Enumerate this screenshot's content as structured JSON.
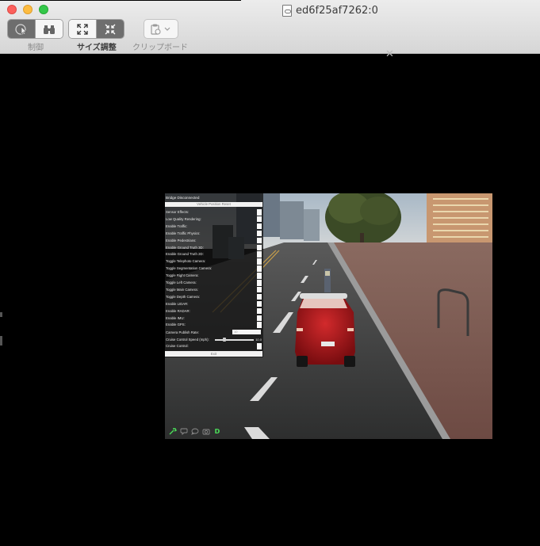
{
  "window": {
    "title": "ed6f25af7262:0"
  },
  "toolbar": {
    "control_label": "制御",
    "resize_label": "サイズ調整",
    "clipboard_label": "クリップボード"
  },
  "icons": {
    "control_pointer": "pointer-icon",
    "control_binoculars": "binoculars-icon",
    "resize_expand": "expand-icon",
    "resize_shrink": "shrink-icon",
    "clipboard": "clipboard-icon",
    "close": "close-icon"
  },
  "sim": {
    "status": "Bridge Disconnected",
    "reset_label": "Vehicle Position Reset",
    "exit_label": "Exit",
    "toggles": [
      "Sensor Effects:",
      "Low Quality Rendering:",
      "Enable Traffic:",
      "Enable Traffic Physics:",
      "Enable Pedestrians:",
      "Enable Ground Truth 3D:",
      "Enable Ground Truth 2D:",
      "Toggle Telephoto Camera:",
      "Toggle Segmentation Camera:",
      "Toggle Right Camera:",
      "Toggle Left Camera:",
      "Toggle Main Camera:",
      "Toggle Depth Camera:",
      "Enable LIDAR:",
      "Enable RADAR:",
      "Enable IMU:",
      "Enable GPS:"
    ],
    "publish_rate_label": "Camera Publish Rate:",
    "publish_rate_value": "10",
    "cruise_speed_label": "Cruise Control Speed (mph):",
    "cruise_speed_value": "10.0",
    "cruise_control_label": "Cruise Control:",
    "bottom_icons": [
      "wrench-icon",
      "speech-bubble-icon",
      "chat-icon",
      "camera-icon"
    ],
    "bottom_letter": "D",
    "colors": {
      "accent_green": "#4be05a",
      "car_red": "#b3151b"
    }
  }
}
